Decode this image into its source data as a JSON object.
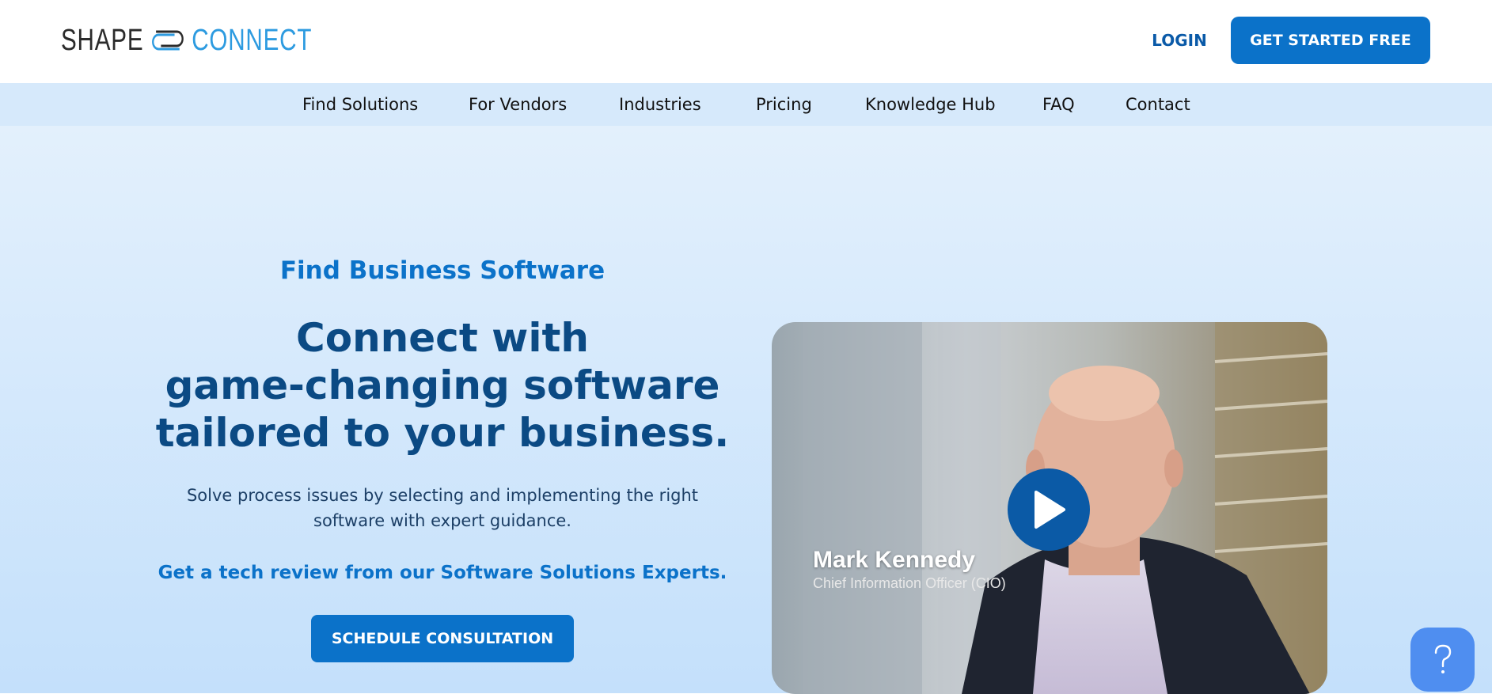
{
  "header": {
    "logo": {
      "word1": "SHAPE",
      "word2": "CONNECT"
    },
    "login_label": "LOGIN",
    "cta_label": "GET STARTED FREE"
  },
  "nav": {
    "items": [
      {
        "label": "Find Solutions"
      },
      {
        "label": "For Vendors"
      },
      {
        "label": "Industries"
      },
      {
        "label": "Pricing"
      },
      {
        "label": "Knowledge Hub"
      },
      {
        "label": "FAQ"
      },
      {
        "label": "Contact"
      }
    ]
  },
  "hero": {
    "eyebrow": "Find Business Software",
    "headline_lines": [
      "Connect with",
      "game-changing software",
      "tailored to your business."
    ],
    "subtext_lines": [
      "Solve process issues by selecting and implementing the right",
      "software with expert guidance."
    ],
    "tech_review": "Get a tech review from our Software Solutions Experts.",
    "cta_label": "SCHEDULE CONSULTATION"
  },
  "video": {
    "person_name": "Mark Kennedy",
    "person_title": "Chief Information Officer (CIO)",
    "play_icon": "play-icon"
  },
  "help": {
    "icon": "question-icon",
    "symbol": "?"
  },
  "colors": {
    "brand_blue": "#0b72c9",
    "dark_blue": "#0b4a84",
    "logo_accent": "#2d9be0",
    "help_blue": "#4f8ef0"
  }
}
